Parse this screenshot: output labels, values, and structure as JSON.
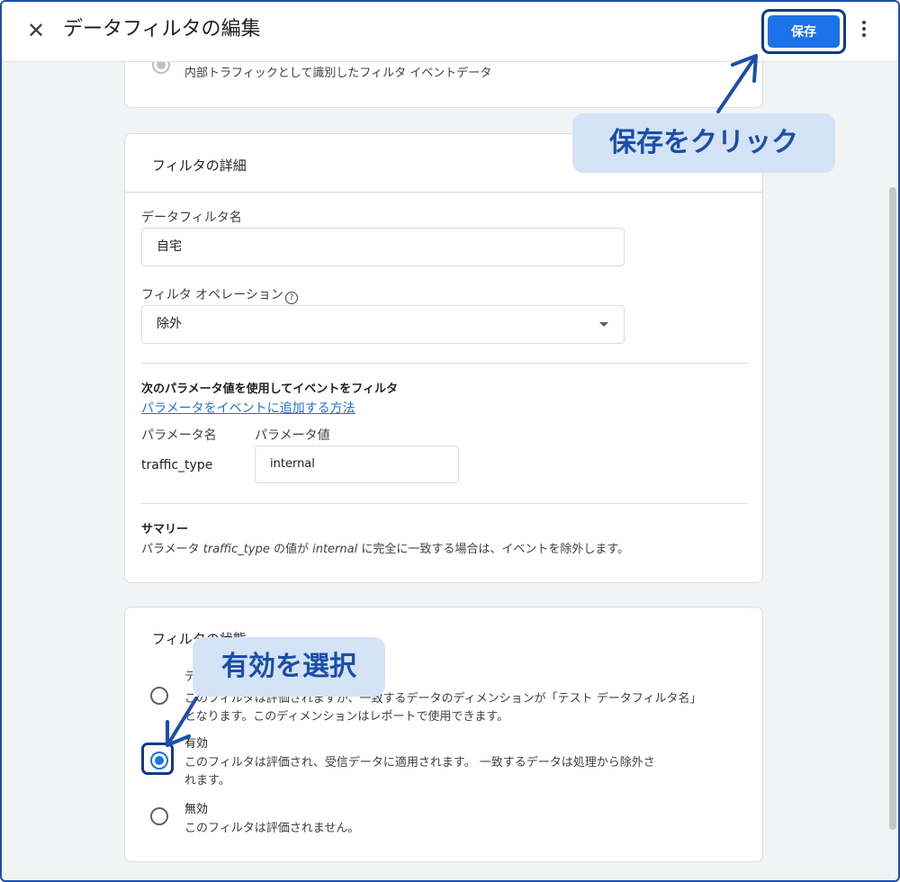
{
  "header": {
    "close_icon": "close-icon",
    "title": "データフィルタの編集",
    "save_label": "保存",
    "more_icon": "more-vert-icon"
  },
  "top_card": {
    "option_desc": "内部トラフィックとして識別したフィルタ イベントデータ"
  },
  "details": {
    "section_title": "フィルタの詳細",
    "name_label": "データフィルタ名",
    "name_value": "自宅",
    "operation_label": "フィルタ オペレーション",
    "help_icon": "help-circle-icon",
    "operation_value": "除外",
    "param_heading": "次のパラメータ値を使用してイベントをフィルタ",
    "param_link": "パラメータをイベントに追加する方法",
    "param_name_header": "パラメータ名",
    "param_value_header": "パラメータ値",
    "param_name": "traffic_type",
    "param_value": "internal",
    "summary_title": "サマリー",
    "summary_pre": "パラメータ ",
    "summary_param": "traffic_type",
    "summary_mid": " の値が ",
    "summary_value": "internal",
    "summary_post": " に完全に一致する場合は、イベントを除外します。"
  },
  "state": {
    "section_title": "フィルタの状態",
    "test_label": "テスト",
    "test_desc_line1": "このフィルタは評価されますが、一致するデータのディメンションが「テスト データフィルタ名」",
    "test_desc_line2": "となります。このディメンションはレポートで使用できます。",
    "active_label": "有効",
    "active_desc_line1": "このフィルタは評価され、受信データに適用されます。 一致するデータは処理から除外さ",
    "active_desc_line2": "れます。",
    "inactive_label": "無効",
    "inactive_desc": "このフィルタは評価されません。",
    "selected": "有効"
  },
  "annotations": {
    "save_callout": "保存をクリック",
    "select_callout": "有効を選択"
  },
  "colors": {
    "accent": "#1a73e8",
    "annotation_blue": "#1a4ea8",
    "callout_bg": "#d4e3f5"
  }
}
